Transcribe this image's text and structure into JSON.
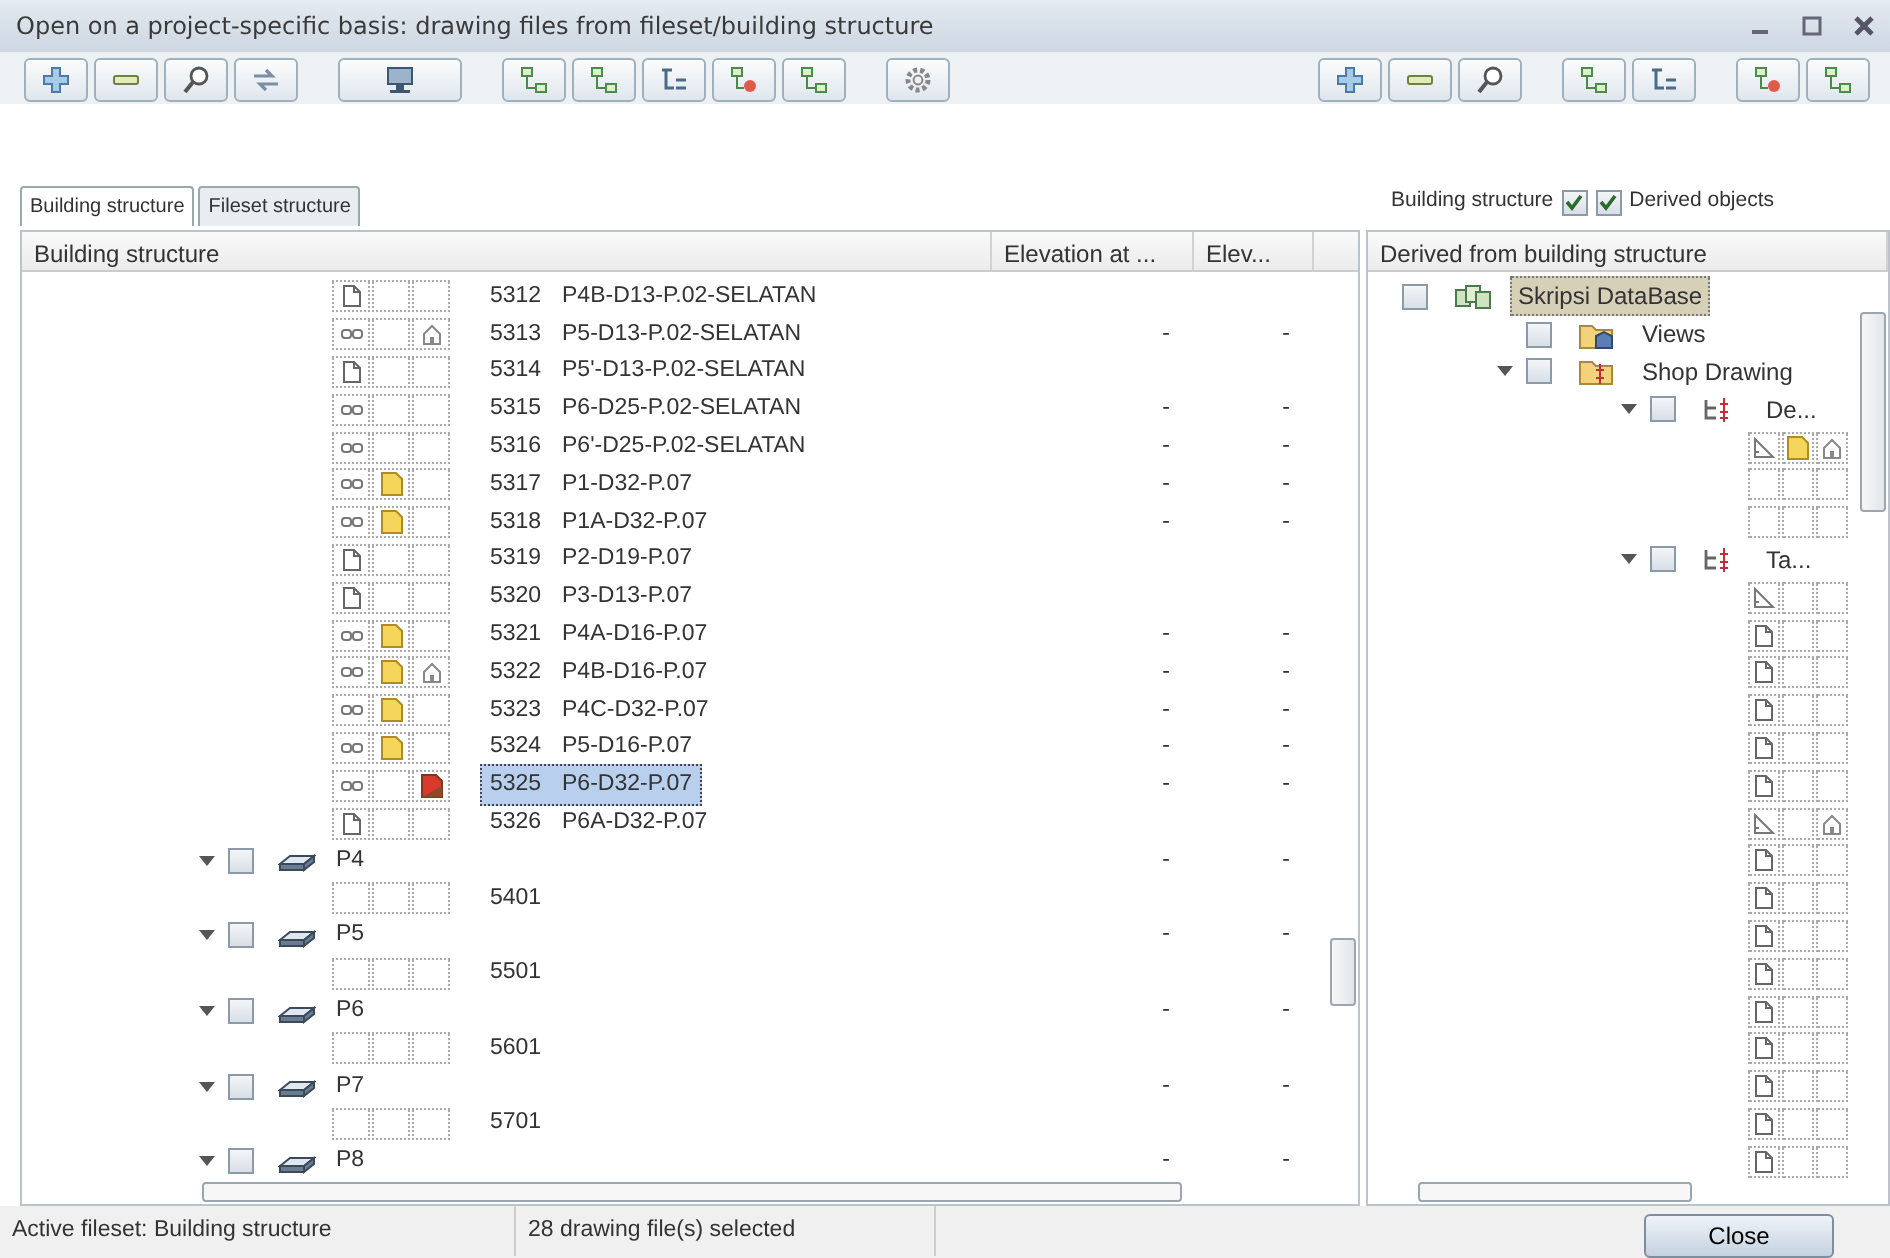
{
  "window": {
    "title": "Open on a project-specific basis: drawing files from fileset/building structure"
  },
  "tabs": [
    {
      "label": "Building structure",
      "selected": true
    },
    {
      "label": "Fileset structure",
      "selected": false
    }
  ],
  "filters": [
    {
      "kind": "label_first",
      "label": "Building structure",
      "checked": true
    },
    {
      "kind": "label_after",
      "label": "Derived objects",
      "checked": true
    }
  ],
  "left_tree": {
    "columns": [
      "Building structure",
      "Elevation at ...",
      "Elev..."
    ],
    "rows": [
      {
        "kind": "file",
        "number": "5312",
        "name": "P4B-D13-P.02-SELATAN",
        "slots": [
          {
            "kind": "doc"
          },
          {
            "kind": "none"
          },
          {
            "kind": "none"
          }
        ],
        "selected": false
      },
      {
        "kind": "file",
        "number": "5313",
        "name": "P5-D13-P.02-SELATAN",
        "slots": [
          {
            "kind": "linked"
          },
          {
            "kind": "none"
          },
          {
            "kind": "reference"
          }
        ],
        "elevation_1": "-",
        "elevation_2": "-",
        "selected": false
      },
      {
        "kind": "file",
        "number": "5314",
        "name": "P5'-D13-P.02-SELATAN",
        "slots": [
          {
            "kind": "doc"
          },
          {
            "kind": "none"
          },
          {
            "kind": "none"
          }
        ],
        "selected": false
      },
      {
        "kind": "file",
        "number": "5315",
        "name": "P6-D25-P.02-SELATAN",
        "slots": [
          {
            "kind": "linked"
          },
          {
            "kind": "none"
          },
          {
            "kind": "none"
          }
        ],
        "elevation_1": "-",
        "elevation_2": "-",
        "selected": false
      },
      {
        "kind": "file",
        "number": "5316",
        "name": "P6'-D25-P.02-SELATAN",
        "slots": [
          {
            "kind": "linked"
          },
          {
            "kind": "none"
          },
          {
            "kind": "none"
          }
        ],
        "elevation_1": "-",
        "elevation_2": "-",
        "selected": false
      },
      {
        "kind": "file",
        "number": "5317",
        "name": "P1-D32-P.07",
        "slots": [
          {
            "kind": "linked"
          },
          {
            "kind": "open"
          },
          {
            "kind": "none"
          }
        ],
        "elevation_1": "-",
        "elevation_2": "-",
        "selected": false
      },
      {
        "kind": "file",
        "number": "5318",
        "name": "P1A-D32-P.07",
        "slots": [
          {
            "kind": "linked"
          },
          {
            "kind": "open"
          },
          {
            "kind": "none"
          }
        ],
        "elevation_1": "-",
        "elevation_2": "-",
        "selected": false
      },
      {
        "kind": "file",
        "number": "5319",
        "name": "P2-D19-P.07",
        "slots": [
          {
            "kind": "doc"
          },
          {
            "kind": "none"
          },
          {
            "kind": "none"
          }
        ],
        "selected": false
      },
      {
        "kind": "file",
        "number": "5320",
        "name": "P3-D13-P.07",
        "slots": [
          {
            "kind": "doc"
          },
          {
            "kind": "none"
          },
          {
            "kind": "none"
          }
        ],
        "selected": false
      },
      {
        "kind": "file",
        "number": "5321",
        "name": "P4A-D16-P.07",
        "slots": [
          {
            "kind": "linked"
          },
          {
            "kind": "open"
          },
          {
            "kind": "none"
          }
        ],
        "elevation_1": "-",
        "elevation_2": "-",
        "selected": false
      },
      {
        "kind": "file",
        "number": "5322",
        "name": "P4B-D16-P.07",
        "slots": [
          {
            "kind": "linked"
          },
          {
            "kind": "open"
          },
          {
            "kind": "reference"
          }
        ],
        "elevation_1": "-",
        "elevation_2": "-",
        "selected": false
      },
      {
        "kind": "file",
        "number": "5323",
        "name": "P4C-D32-P.07",
        "slots": [
          {
            "kind": "linked"
          },
          {
            "kind": "open"
          },
          {
            "kind": "none"
          }
        ],
        "elevation_1": "-",
        "elevation_2": "-",
        "selected": false
      },
      {
        "kind": "file",
        "number": "5324",
        "name": "P5-D16-P.07",
        "slots": [
          {
            "kind": "linked"
          },
          {
            "kind": "open"
          },
          {
            "kind": "none"
          }
        ],
        "elevation_1": "-",
        "elevation_2": "-",
        "selected": false
      },
      {
        "kind": "file",
        "number": "5325",
        "name": "P6-D32-P.07",
        "slots": [
          {
            "kind": "linked"
          },
          {
            "kind": "none"
          },
          {
            "kind": "active"
          }
        ],
        "elevation_1": "-",
        "elevation_2": "-",
        "selected": true
      },
      {
        "kind": "file",
        "number": "5326",
        "name": "P6A-D32-P.07",
        "slots": [
          {
            "kind": "doc"
          },
          {
            "kind": "none"
          },
          {
            "kind": "none"
          }
        ],
        "selected": false
      },
      {
        "kind": "level",
        "label": "P4",
        "expanded": true,
        "checked": false,
        "elevation_1": "-",
        "elevation_2": "-",
        "selected": false,
        "children": [
          {
            "kind": "file",
            "number": "5401",
            "slots": [
              {
                "kind": "none"
              },
              {
                "kind": "none"
              },
              {
                "kind": "none"
              }
            ],
            "selected": false
          }
        ]
      },
      {
        "kind": "level",
        "label": "P5",
        "expanded": true,
        "checked": false,
        "elevation_1": "-",
        "elevation_2": "-",
        "selected": false,
        "children": [
          {
            "kind": "file",
            "number": "5501",
            "slots": [
              {
                "kind": "none"
              },
              {
                "kind": "none"
              },
              {
                "kind": "none"
              }
            ],
            "selected": false
          }
        ]
      },
      {
        "kind": "level",
        "label": "P6",
        "expanded": true,
        "checked": false,
        "elevation_1": "-",
        "elevation_2": "-",
        "selected": false,
        "children": [
          {
            "kind": "file",
            "number": "5601",
            "slots": [
              {
                "kind": "none"
              },
              {
                "kind": "none"
              },
              {
                "kind": "none"
              }
            ],
            "selected": false
          }
        ]
      },
      {
        "kind": "level",
        "label": "P7",
        "expanded": true,
        "checked": false,
        "elevation_1": "-",
        "elevation_2": "-",
        "selected": false,
        "children": [
          {
            "kind": "file",
            "number": "5701",
            "slots": [
              {
                "kind": "none"
              },
              {
                "kind": "none"
              },
              {
                "kind": "none"
              }
            ],
            "selected": false
          }
        ]
      },
      {
        "kind": "level",
        "label": "P8",
        "expanded": true,
        "checked": false,
        "elevation_1": "-",
        "elevation_2": "-",
        "selected": false
      }
    ]
  },
  "right_tree": {
    "column": "Derived from building structure",
    "nodes": [
      {
        "kind": "database",
        "label": "Skripsi DataBase",
        "checked": false,
        "selected": true,
        "children": [
          {
            "kind": "views",
            "label": "Views",
            "checked": false,
            "selected": false
          },
          {
            "kind": "group",
            "label": "Shop Drawing",
            "checked": false,
            "expanded": true,
            "selected": false,
            "children": [
              {
                "kind": "structure",
                "label": "De...",
                "checked": false,
                "expanded": true,
                "selected": false,
                "children": [
                  {
                    "kind": "slots",
                    "slots": [
                      {
                        "kind": "ruler"
                      },
                      {
                        "kind": "open"
                      },
                      {
                        "kind": "reference"
                      }
                    ]
                  },
                  {
                    "kind": "slots",
                    "slots": [
                      {
                        "kind": "none"
                      },
                      {
                        "kind": "none"
                      },
                      {
                        "kind": "none"
                      }
                    ]
                  },
                  {
                    "kind": "slots",
                    "slots": [
                      {
                        "kind": "none"
                      },
                      {
                        "kind": "none"
                      },
                      {
                        "kind": "none"
                      }
                    ]
                  }
                ]
              },
              {
                "kind": "structure",
                "label": "Ta...",
                "checked": false,
                "expanded": true,
                "selected": false,
                "children": [
                  {
                    "kind": "slots",
                    "slots": [
                      {
                        "kind": "ruler"
                      },
                      {
                        "kind": "none"
                      },
                      {
                        "kind": "none"
                      }
                    ]
                  },
                  {
                    "kind": "slots",
                    "slots": [
                      {
                        "kind": "doc"
                      },
                      {
                        "kind": "none"
                      },
                      {
                        "kind": "none"
                      }
                    ]
                  },
                  {
                    "kind": "slots",
                    "slots": [
                      {
                        "kind": "doc"
                      },
                      {
                        "kind": "none"
                      },
                      {
                        "kind": "none"
                      }
                    ]
                  },
                  {
                    "kind": "slots",
                    "slots": [
                      {
                        "kind": "doc"
                      },
                      {
                        "kind": "none"
                      },
                      {
                        "kind": "none"
                      }
                    ]
                  },
                  {
                    "kind": "slots",
                    "slots": [
                      {
                        "kind": "doc"
                      },
                      {
                        "kind": "none"
                      },
                      {
                        "kind": "none"
                      }
                    ]
                  },
                  {
                    "kind": "slots",
                    "slots": [
                      {
                        "kind": "doc"
                      },
                      {
                        "kind": "none"
                      },
                      {
                        "kind": "none"
                      }
                    ]
                  },
                  {
                    "kind": "slots",
                    "slots": [
                      {
                        "kind": "ruler"
                      },
                      {
                        "kind": "none"
                      },
                      {
                        "kind": "reference"
                      }
                    ]
                  },
                  {
                    "kind": "slots",
                    "slots": [
                      {
                        "kind": "doc"
                      },
                      {
                        "kind": "none"
                      },
                      {
                        "kind": "none"
                      }
                    ]
                  },
                  {
                    "kind": "slots",
                    "slots": [
                      {
                        "kind": "doc"
                      },
                      {
                        "kind": "none"
                      },
                      {
                        "kind": "none"
                      }
                    ]
                  },
                  {
                    "kind": "slots",
                    "slots": [
                      {
                        "kind": "doc"
                      },
                      {
                        "kind": "none"
                      },
                      {
                        "kind": "none"
                      }
                    ]
                  },
                  {
                    "kind": "slots",
                    "slots": [
                      {
                        "kind": "doc"
                      },
                      {
                        "kind": "none"
                      },
                      {
                        "kind": "none"
                      }
                    ]
                  },
                  {
                    "kind": "slots",
                    "slots": [
                      {
                        "kind": "doc"
                      },
                      {
                        "kind": "none"
                      },
                      {
                        "kind": "none"
                      }
                    ]
                  },
                  {
                    "kind": "slots",
                    "slots": [
                      {
                        "kind": "doc"
                      },
                      {
                        "kind": "none"
                      },
                      {
                        "kind": "none"
                      }
                    ]
                  },
                  {
                    "kind": "slots",
                    "slots": [
                      {
                        "kind": "doc"
                      },
                      {
                        "kind": "none"
                      },
                      {
                        "kind": "none"
                      }
                    ]
                  },
                  {
                    "kind": "slots",
                    "slots": [
                      {
                        "kind": "doc"
                      },
                      {
                        "kind": "none"
                      },
                      {
                        "kind": "none"
                      }
                    ]
                  },
                  {
                    "kind": "slots",
                    "slots": [
                      {
                        "kind": "doc"
                      },
                      {
                        "kind": "none"
                      },
                      {
                        "kind": "none"
                      }
                    ]
                  }
                ]
              }
            ]
          }
        ]
      }
    ]
  },
  "status_bar": [
    "Active fileset: Building structure",
    "28 drawing file(s) selected"
  ],
  "buttons": [
    "Close"
  ]
}
